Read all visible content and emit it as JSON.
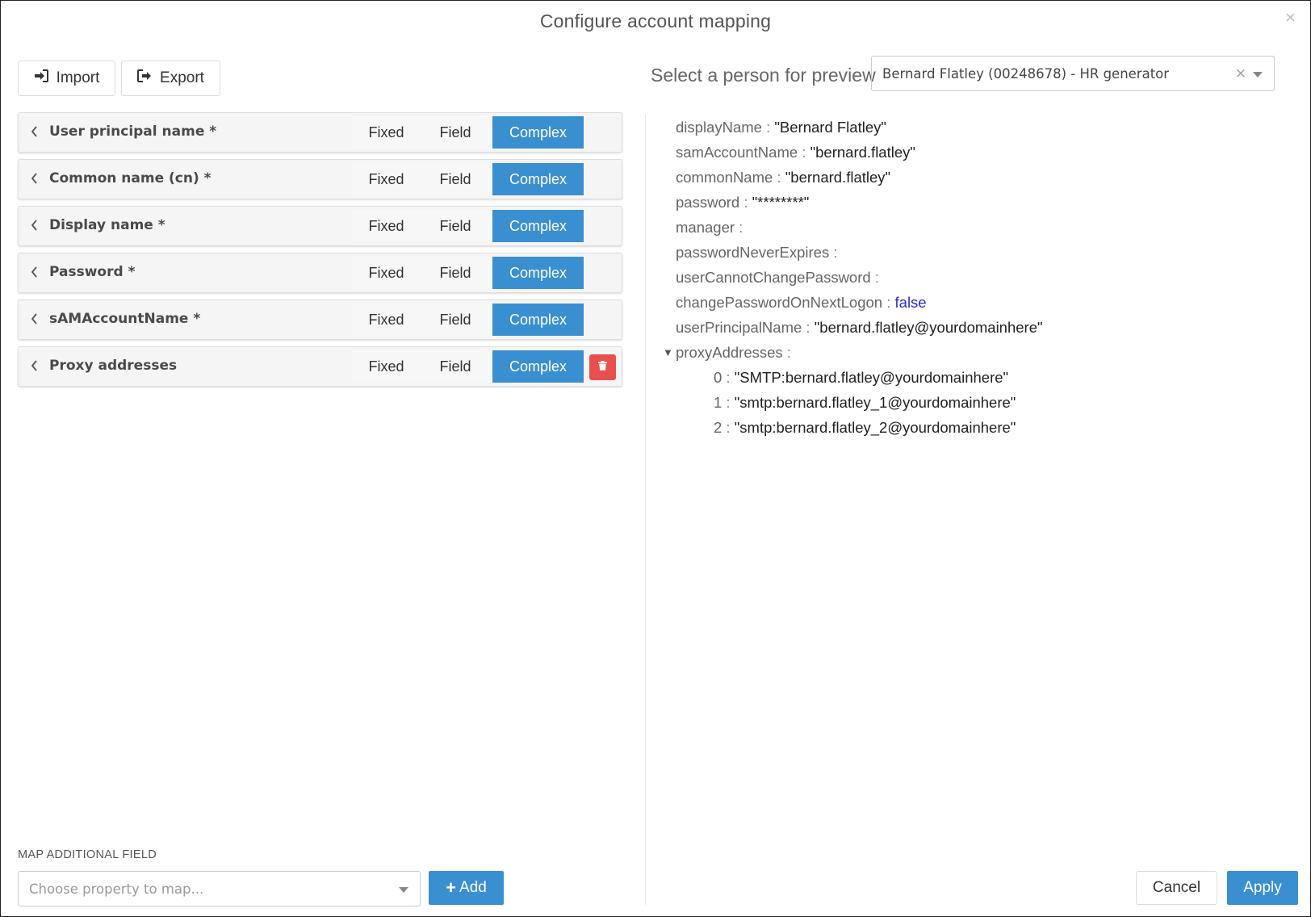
{
  "dialog": {
    "title": "Configure account mapping",
    "close_symbol": "×"
  },
  "toolbar": {
    "import_label": "Import",
    "import_icon": "sign-in-icon",
    "export_label": "Export",
    "export_icon": "sign-out-icon"
  },
  "mapping": {
    "mode_labels": {
      "fixed": "Fixed",
      "field": "Field",
      "complex": "Complex"
    },
    "selected_mode_color": "#3a8fd1",
    "delete_color": "#e84f4f",
    "rows": [
      {
        "label": "User principal name *",
        "selected": "Complex",
        "deletable": false
      },
      {
        "label": "Common name (cn) *",
        "selected": "Complex",
        "deletable": false
      },
      {
        "label": "Display name *",
        "selected": "Complex",
        "deletable": false
      },
      {
        "label": "Password *",
        "selected": "Complex",
        "deletable": false
      },
      {
        "label": "sAMAccountName *",
        "selected": "Complex",
        "deletable": false
      },
      {
        "label": "Proxy addresses",
        "selected": "Complex",
        "deletable": true
      }
    ]
  },
  "preview": {
    "label": "Select a person for preview",
    "selected_person": "Bernard Flatley (00248678) - HR generator",
    "clear_symbol": "×",
    "properties": [
      {
        "key": "displayName",
        "value": "\"Bernard Flatley\""
      },
      {
        "key": "samAccountName",
        "value": "\"bernard.flatley\""
      },
      {
        "key": "commonName",
        "value": "\"bernard.flatley\""
      },
      {
        "key": "password",
        "value": "\"********\""
      },
      {
        "key": "manager",
        "value": ""
      },
      {
        "key": "passwordNeverExpires",
        "value": ""
      },
      {
        "key": "userCannotChangePassword",
        "value": ""
      },
      {
        "key": "changePasswordOnNextLogon",
        "value": "false",
        "type": "boolean"
      },
      {
        "key": "userPrincipalName",
        "value": "\"bernard.flatley@yourdomainhere\""
      }
    ],
    "proxy": {
      "key": "proxyAddresses",
      "toggle_symbol": "▼",
      "items": [
        {
          "index": "0",
          "value": "\"SMTP:bernard.flatley@yourdomainhere\""
        },
        {
          "index": "1",
          "value": "\"smtp:bernard.flatley_1@yourdomainhere\""
        },
        {
          "index": "2",
          "value": "\"smtp:bernard.flatley_2@yourdomainhere\""
        }
      ]
    }
  },
  "footer": {
    "map_additional_label": "MAP ADDITIONAL FIELD",
    "property_placeholder": "Choose property to map...",
    "add_label": "Add",
    "add_symbol": "+",
    "cancel_label": "Cancel",
    "apply_label": "Apply"
  }
}
